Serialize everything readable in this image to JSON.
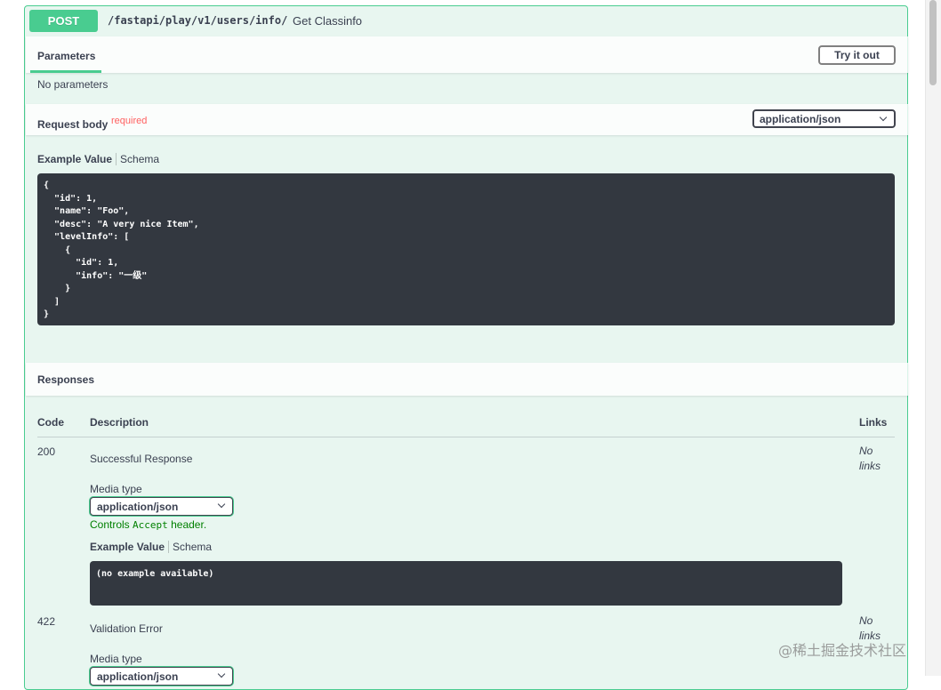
{
  "operation": {
    "method": "POST",
    "path": "/fastapi/play/v1/users/info/",
    "summary": "Get Classinfo"
  },
  "parameters": {
    "tab_label": "Parameters",
    "try_button": "Try it out",
    "empty_text": "No parameters"
  },
  "request_body": {
    "title": "Request body",
    "required_label": "required",
    "content_type": "application/json",
    "example_tab": "Example Value",
    "schema_tab": "Schema",
    "example_code": "{\n  \"id\": 1,\n  \"name\": \"Foo\",\n  \"desc\": \"A very nice Item\",\n  \"levelInfo\": [\n    {\n      \"id\": 1,\n      \"info\": \"一级\"\n    }\n  ]\n}"
  },
  "responses": {
    "title": "Responses",
    "columns": {
      "code": "Code",
      "description": "Description",
      "links": "Links"
    },
    "items": [
      {
        "code": "200",
        "description": "Successful Response",
        "links_line1": "No",
        "links_line2": "links",
        "media_type_label": "Media type",
        "media_type": "application/json",
        "controls_prefix": "Controls ",
        "controls_code": "Accept",
        "controls_suffix": " header.",
        "example_tab": "Example Value",
        "schema_tab": "Schema",
        "example_code": "(no example available)"
      },
      {
        "code": "422",
        "description": "Validation Error",
        "links_line1": "No",
        "links_line2": "links",
        "media_type_label": "Media type",
        "media_type": "application/json"
      }
    ]
  },
  "watermark": "@稀土掘金技术社区",
  "colors": {
    "post": "#49cc90",
    "code_bg": "#333840",
    "required": "#ff6060",
    "controls": "#008000"
  }
}
